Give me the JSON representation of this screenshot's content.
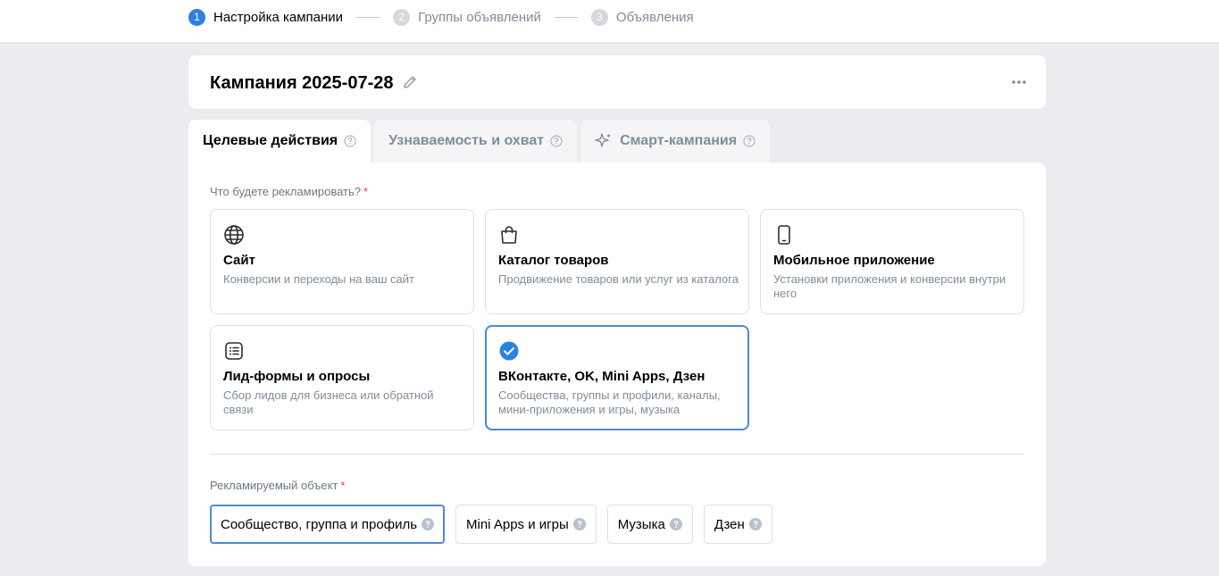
{
  "steps": [
    {
      "num": "1",
      "label": "Настройка кампании"
    },
    {
      "num": "2",
      "label": "Группы объявлений"
    },
    {
      "num": "3",
      "label": "Объявления"
    }
  ],
  "campaign": {
    "name": "Кампания 2025-07-28"
  },
  "tabs": [
    {
      "label": "Целевые действия"
    },
    {
      "label": "Узнаваемость и охват"
    },
    {
      "label": "Смарт-кампания"
    }
  ],
  "objective": {
    "label": "Что будете рекламировать?",
    "required_mark": "*",
    "options": [
      {
        "title": "Сайт",
        "desc": "Конверсии и переходы на ваш сайт",
        "icon": "globe-icon"
      },
      {
        "title": "Каталог товаров",
        "desc": "Продвижение товаров или услуг из каталога",
        "icon": "shopping-bag-icon"
      },
      {
        "title": "Мобильное приложение",
        "desc": "Установки приложения и конверсии внутри него",
        "icon": "smartphone-icon"
      },
      {
        "title": "Лид-формы и опросы",
        "desc": "Сбор лидов для бизнеса или обратной связи",
        "icon": "list-form-icon"
      },
      {
        "title": "ВКонтакте, OK, Mini Apps, Дзен",
        "desc": "Сообщества, группы и профили, каналы, мини-приложения и игры, музыка",
        "icon": "check-circle-icon"
      }
    ]
  },
  "promoted": {
    "label": "Рекламируемый объект",
    "required_mark": "*",
    "chips": [
      {
        "label": "Сообщество, группа и профиль"
      },
      {
        "label": "Mini Apps и игры"
      },
      {
        "label": "Музыка"
      },
      {
        "label": "Дзен"
      }
    ]
  },
  "colors": {
    "accent": "#2d81e0",
    "selected_border": "#4b8ad6",
    "required": "#e64646"
  }
}
